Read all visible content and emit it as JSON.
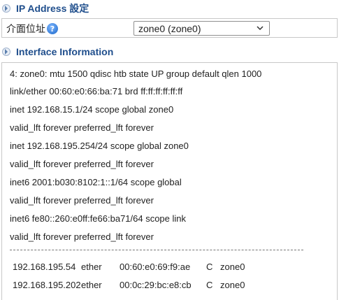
{
  "ip_section": {
    "title": "IP Address 設定",
    "interface_label": "介面位址",
    "help_icon": "question-circle-icon",
    "interface_selected": "zone0 (zone0)"
  },
  "info_section": {
    "title": "Interface Information",
    "lines": [
      "4: zone0: mtu 1500 qdisc htb state UP group default qlen 1000",
      "link/ether 00:60:e0:66:ba:71 brd ff:ff:ff:ff:ff:ff",
      "inet 192.168.15.1/24 scope global zone0",
      "valid_lft forever preferred_lft forever",
      "inet 192.168.195.254/24 scope global zone0",
      "valid_lft forever preferred_lft forever",
      "inet6 2001:b030:8102:1::1/64 scope global",
      "valid_lft forever preferred_lft forever",
      "inet6 fe80::260:e0ff:fe66:ba71/64 scope link",
      "valid_lft forever preferred_lft forever"
    ],
    "arp": [
      {
        "ip": "192.168.195.54",
        "type": "ether",
        "mac": "00:60:e0:69:f9:ae",
        "flag": "C",
        "iface": "zone0"
      },
      {
        "ip": "192.168.195.202",
        "type": "ether",
        "mac": "00:0c:29:bc:e8:cb",
        "flag": "C",
        "iface": "zone0"
      }
    ]
  },
  "colors": {
    "section_title": "#1f4e8c",
    "border": "#c8c8c8"
  }
}
